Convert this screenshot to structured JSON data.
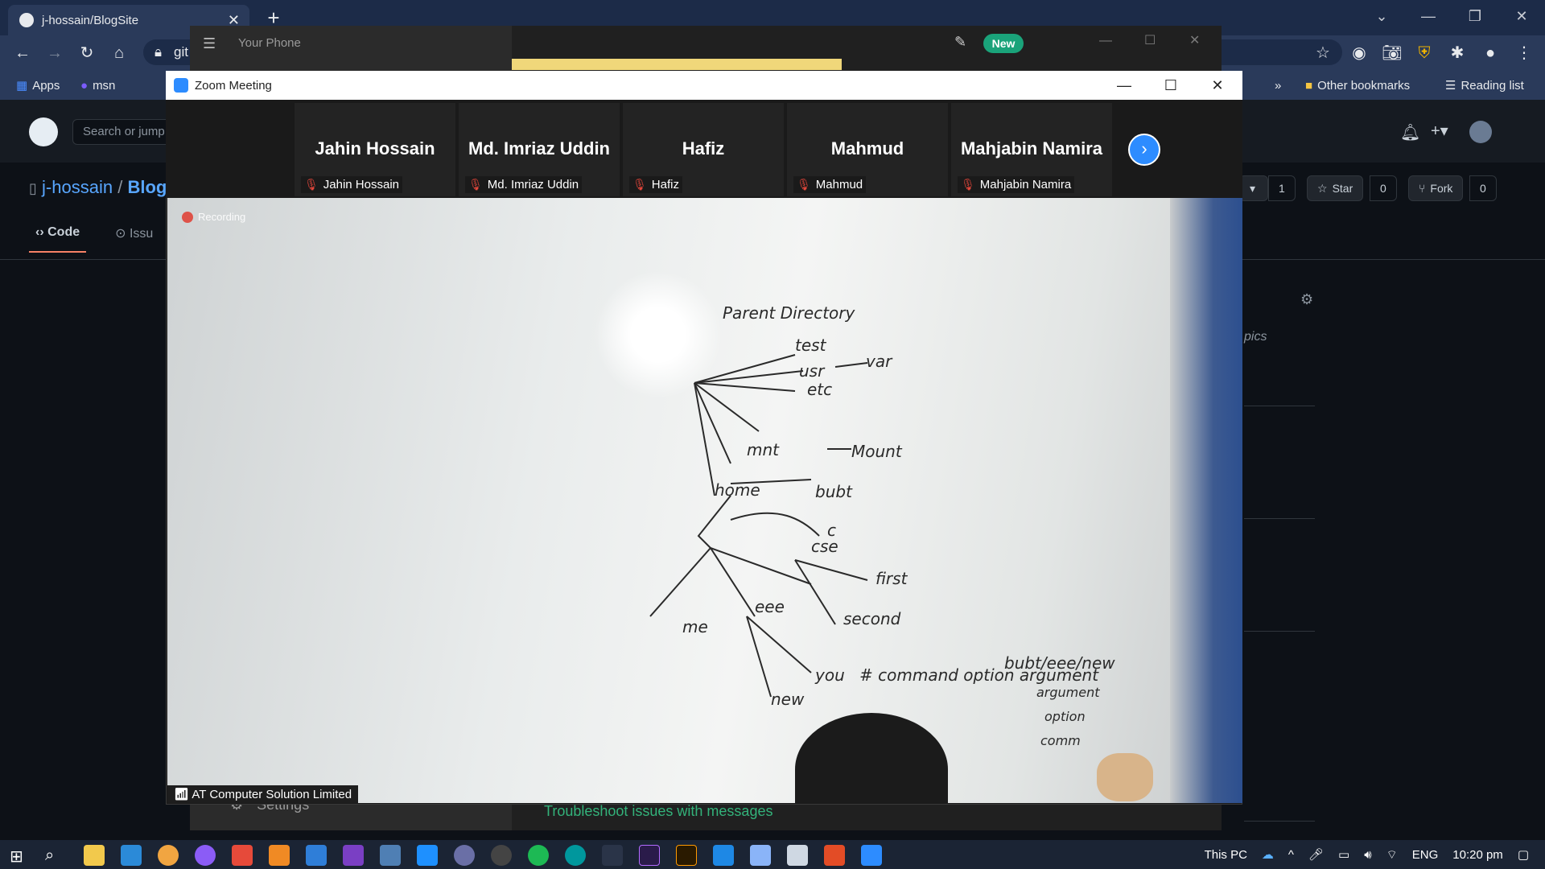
{
  "chrome": {
    "tab_title": "j-hossain/BlogSite",
    "omnibox_text": "git",
    "bookmarks": [
      "Apps",
      "msn"
    ],
    "other_bookmarks": "Other bookmarks",
    "reading_list": "Reading list"
  },
  "github": {
    "search_placeholder": "Search or jump",
    "owner": "j-hossain",
    "repo_partial": "Blog",
    "tab_code": "Code",
    "tab_issues_partial": "Issu",
    "watch_count": "1",
    "star_label": "Star",
    "star_count": "0",
    "fork_label": "Fork",
    "fork_count": "0",
    "topics_partial": "pics"
  },
  "your_phone": {
    "title": "Your Phone",
    "new_badge": "New",
    "settings_label": "Settings",
    "troubleshoot": "Troubleshoot issues with messages"
  },
  "zoom": {
    "title": "Zoom Meeting",
    "recording": "Recording",
    "host_label": "AT Computer Solution Limited",
    "participants": [
      {
        "name": "Jahin Hossain",
        "label": "Jahin Hossain"
      },
      {
        "name": "Md. Imriaz Uddin",
        "label": "Md. Imriaz Uddin"
      },
      {
        "name": "Hafiz",
        "label": "Hafiz"
      },
      {
        "name": "Mahmud",
        "label": "Mahmud"
      },
      {
        "name": "Mahjabin Namira",
        "label": "Mahjabin Namira"
      }
    ],
    "whiteboard": {
      "root": "Parent Directory",
      "nodes": [
        "test",
        "var",
        "usr",
        "etc",
        "mnt",
        "Mount",
        "home",
        "bubt",
        "c",
        "cse",
        "first",
        "second",
        "eee",
        "me",
        "you",
        "new"
      ],
      "note_line1": "# command option argument",
      "note_line2": "bubt/eee/new",
      "note_line3": "argument",
      "note_line4": "option",
      "note_line5": "comm"
    }
  },
  "taskbar": {
    "this_pc": "This PC",
    "lang": "ENG",
    "time": "10:20 pm"
  }
}
